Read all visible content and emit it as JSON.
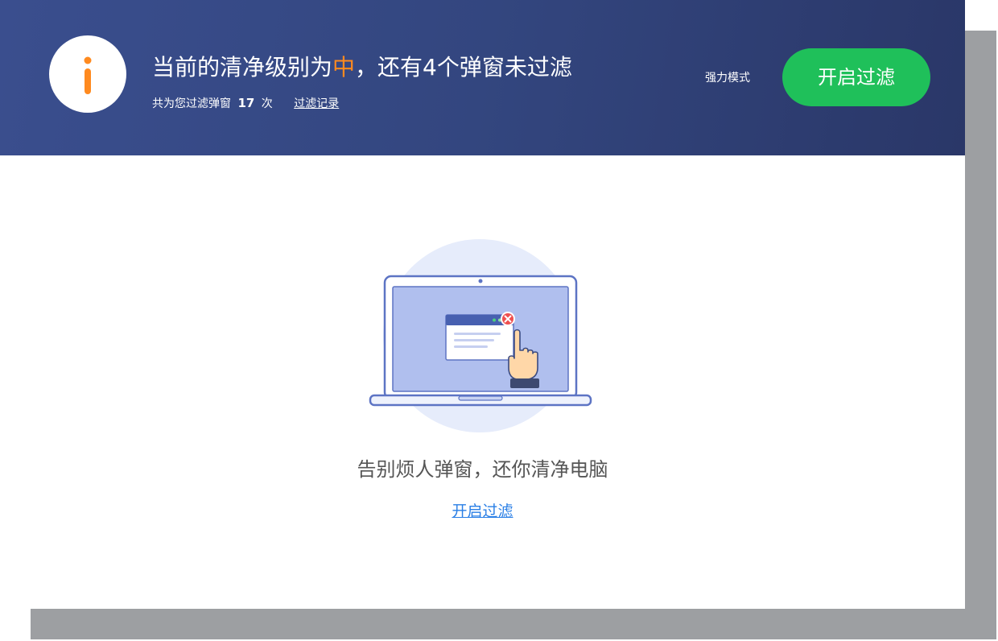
{
  "header": {
    "title_prefix": "当前的清净级别为",
    "level": "中",
    "title_suffix": "，还有4个弹窗未过滤",
    "filtered_prefix": "共为您过滤弹窗",
    "filtered_count": "17",
    "filtered_unit": "次",
    "history_link": "过滤记录",
    "mode_label": "强力模式",
    "enable_button": "开启过滤"
  },
  "main": {
    "slogan": "告别烦人弹窗，还你清净电脑",
    "enable_link": "开启过滤"
  },
  "icons": {
    "info": "info-icon",
    "illustration": "laptop-popup-illustration"
  },
  "colors": {
    "header_bg": "#33467f",
    "accent_orange": "#ff8a1f",
    "button_green": "#1fc05a",
    "link_blue": "#2a7fe6",
    "text_gray": "#555555"
  }
}
